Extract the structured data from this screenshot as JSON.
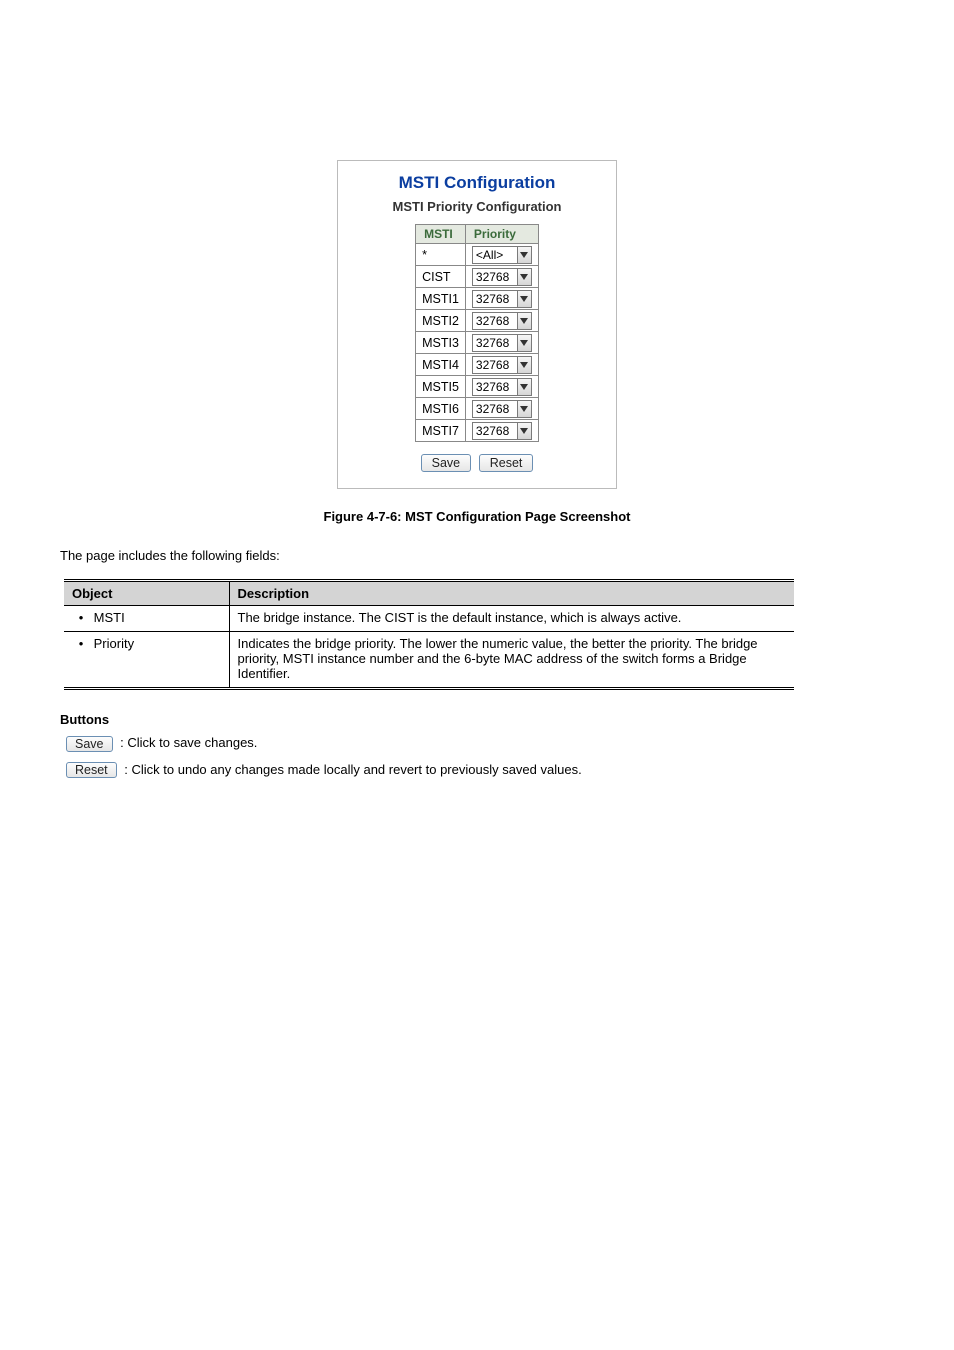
{
  "figure": {
    "title": "MSTI Configuration",
    "subtitle": "MSTI Priority Configuration",
    "headers": {
      "c0": "MSTI",
      "c1": "Priority"
    },
    "rows": [
      {
        "msti": "*",
        "priority": "<All>"
      },
      {
        "msti": "CIST",
        "priority": "32768"
      },
      {
        "msti": "MSTI1",
        "priority": "32768"
      },
      {
        "msti": "MSTI2",
        "priority": "32768"
      },
      {
        "msti": "MSTI3",
        "priority": "32768"
      },
      {
        "msti": "MSTI4",
        "priority": "32768"
      },
      {
        "msti": "MSTI5",
        "priority": "32768"
      },
      {
        "msti": "MSTI6",
        "priority": "32768"
      },
      {
        "msti": "MSTI7",
        "priority": "32768"
      }
    ],
    "save": "Save",
    "reset": "Reset"
  },
  "caption": "Figure 4-7-6: MST Configuration Page Screenshot",
  "lead": "The page includes the following fields:",
  "param_header": {
    "c0": "Object",
    "c1": "Description"
  },
  "params": [
    {
      "obj": "MSTI",
      "desc": "The bridge instance. The CIST is the default instance, which is always active."
    },
    {
      "obj": "Priority",
      "desc": "Indicates the bridge priority. The lower the numeric value, the better the priority. The bridge priority, MSTI instance number and the 6-byte MAC address of the switch forms a Bridge Identifier."
    }
  ],
  "buttons_heading": "Buttons",
  "btn_save": {
    "label": "Save",
    "desc": ": Click to save changes."
  },
  "btn_reset": {
    "label": "Reset",
    "desc": ": Click to undo any changes made locally and revert to previously saved values."
  }
}
